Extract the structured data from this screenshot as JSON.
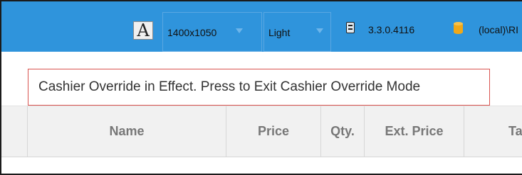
{
  "toolbar": {
    "font_icon_glyph": "A",
    "resolution": "1400x1050",
    "theme": "Light",
    "version": "3.3.0.4116",
    "server": "(local)\\RI",
    "bar_color": "#2f94dc"
  },
  "override_banner": {
    "text": "Cashier Override in Effect. Press to Exit Cashier Override Mode",
    "border_color": "#d9534f"
  },
  "grid": {
    "columns": [
      "Name",
      "Price",
      "Qty.",
      "Ext. Price",
      "Tax"
    ]
  },
  "icons": [
    "font-size-icon",
    "dropdown-caret-icon",
    "version-icon",
    "database-icon"
  ]
}
